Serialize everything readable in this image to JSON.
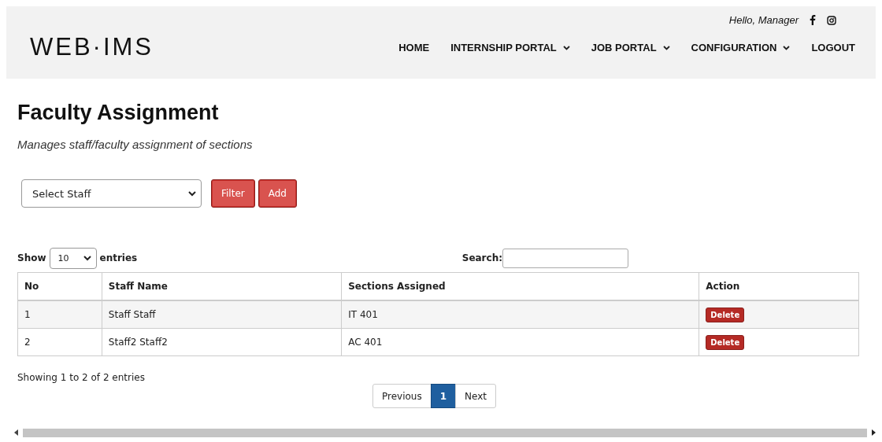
{
  "header": {
    "logo": "WEB·IMS",
    "greeting": "Hello, Manager",
    "nav": [
      {
        "label": "HOME",
        "dropdown": false
      },
      {
        "label": "INTERNSHIP PORTAL",
        "dropdown": true
      },
      {
        "label": "JOB PORTAL",
        "dropdown": true
      },
      {
        "label": "CONFIGURATION",
        "dropdown": true
      },
      {
        "label": "LOGOUT",
        "dropdown": false
      }
    ]
  },
  "page": {
    "title": "Faculty Assignment",
    "subtitle": "Manages staff/faculty assignment of sections"
  },
  "toolbar": {
    "staff_select": "Select Staff",
    "buttons": [
      "Filter",
      "Add"
    ]
  },
  "table": {
    "length_label_before": "Show",
    "length_value": "10",
    "length_label_after": "entries",
    "search_label": "Search:",
    "columns": [
      "No",
      "Staff Name",
      "Sections Assigned",
      "Action"
    ],
    "rows": [
      {
        "no": "1",
        "staff": "Staff Staff",
        "sections": "IT 401",
        "action": "Delete"
      },
      {
        "no": "2",
        "staff": "Staff2 Staff2",
        "sections": "AC 401",
        "action": "Delete"
      }
    ],
    "info": "Showing 1 to 2 of 2 entries",
    "pagination": [
      {
        "label": "Previous",
        "selected": false
      },
      {
        "label": "1",
        "selected": true
      },
      {
        "label": "Next",
        "selected": false
      }
    ]
  }
}
